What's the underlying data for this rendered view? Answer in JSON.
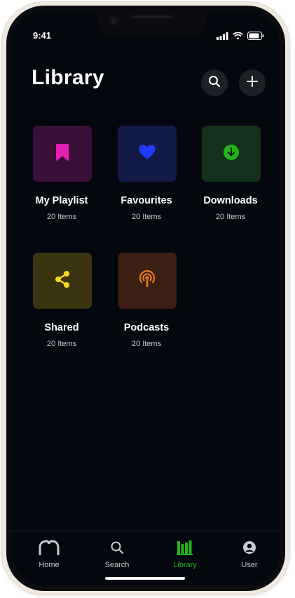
{
  "status_bar": {
    "time": "9:41"
  },
  "header": {
    "title": "Library"
  },
  "actions": {
    "search_icon": "search-icon",
    "add_icon": "plus-icon"
  },
  "tiles": [
    {
      "label": "My Playlist",
      "count": "20 Items",
      "icon": "bookmark-icon",
      "bg": "#3a1039",
      "fg": "#e21fb3"
    },
    {
      "label": "Favourites",
      "count": "20 Items",
      "icon": "heart-icon",
      "bg": "#141a47",
      "fg": "#1f3cff"
    },
    {
      "label": "Downloads",
      "count": "20 Items",
      "icon": "download-icon",
      "bg": "#13301a",
      "fg": "#22b418"
    },
    {
      "label": "Shared",
      "count": "20 Items",
      "icon": "share-icon",
      "bg": "#3a3411",
      "fg": "#f2dc1c"
    },
    {
      "label": "Podcasts",
      "count": "20 Items",
      "icon": "podcast-icon",
      "bg": "#3a1f12",
      "fg": "#e87a1c"
    }
  ],
  "tabbar": {
    "active": "Library",
    "active_color": "#22b418",
    "items": [
      {
        "label": "Home",
        "icon": "home-icon"
      },
      {
        "label": "Search",
        "icon": "search-icon"
      },
      {
        "label": "Library",
        "icon": "library-icon"
      },
      {
        "label": "User",
        "icon": "user-icon"
      }
    ]
  }
}
